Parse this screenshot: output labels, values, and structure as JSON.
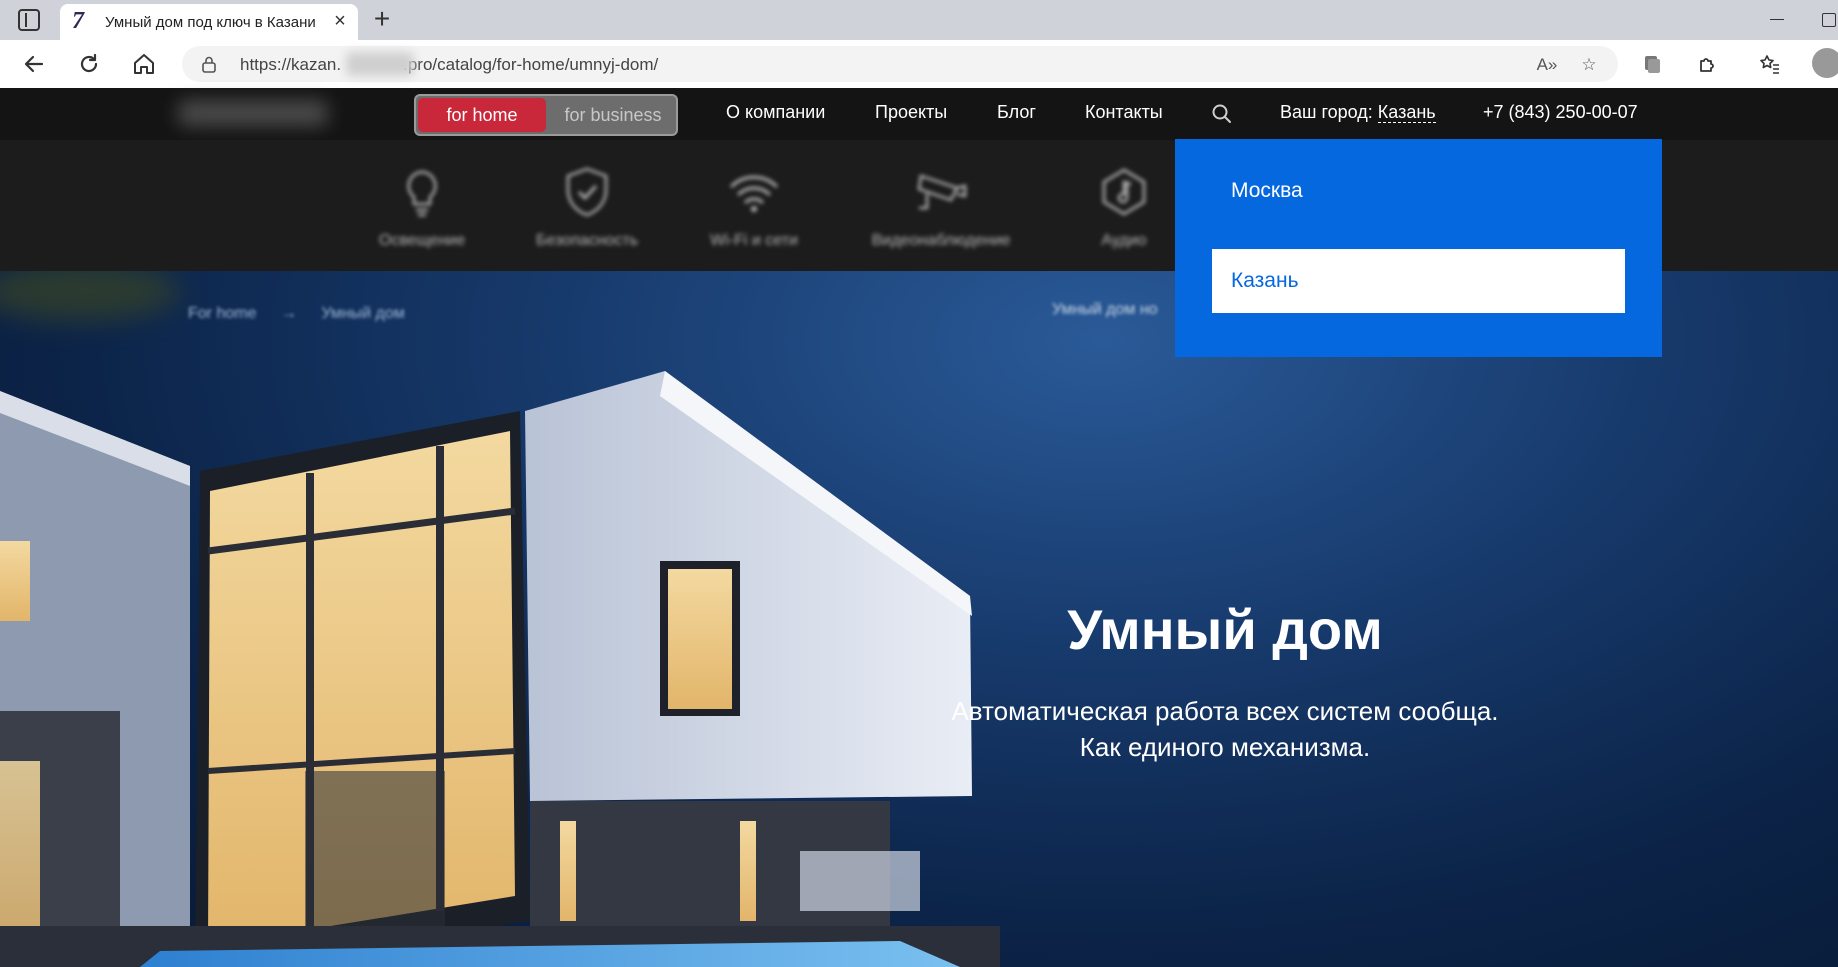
{
  "browser": {
    "tab_title": "Умный дом под ключ в Казани",
    "tab_favicon": "7",
    "url_prefix": "https://kazan.",
    "url_suffix": ".pro/catalog/for-home/umnyj-dom/"
  },
  "header": {
    "segments": {
      "home": "for home",
      "business": "for business"
    },
    "nav": [
      "О компании",
      "Проекты",
      "Блог",
      "Контакты"
    ],
    "city_label": "Ваш город:",
    "city_value": "Казань",
    "phone": "+7 (843) 250-00-07"
  },
  "categories": [
    {
      "label": "Освещение",
      "icon": "lightbulb-icon"
    },
    {
      "label": "Безопасность",
      "icon": "shield-icon"
    },
    {
      "label": "Wi-Fi и сети",
      "icon": "wifi-icon"
    },
    {
      "label": "Видеонаблюдение",
      "icon": "camera-icon"
    },
    {
      "label": "Аудио",
      "icon": "music-icon"
    }
  ],
  "breadcrumb": {
    "items": [
      "For home",
      "Умный дом"
    ],
    "separator": "→"
  },
  "hero": {
    "side_text": "Умный дом но",
    "title": "Умный дом",
    "subtitle_line1": "Автоматическая работа всех систем сообща.",
    "subtitle_line2": "Как единого механизма."
  },
  "city_dropdown": {
    "options": [
      "Москва",
      "Казань"
    ],
    "selected": "Казань"
  },
  "colors": {
    "accent_red": "#c8283a",
    "dropdown_blue": "#0668df",
    "header_bg": "#141414"
  }
}
